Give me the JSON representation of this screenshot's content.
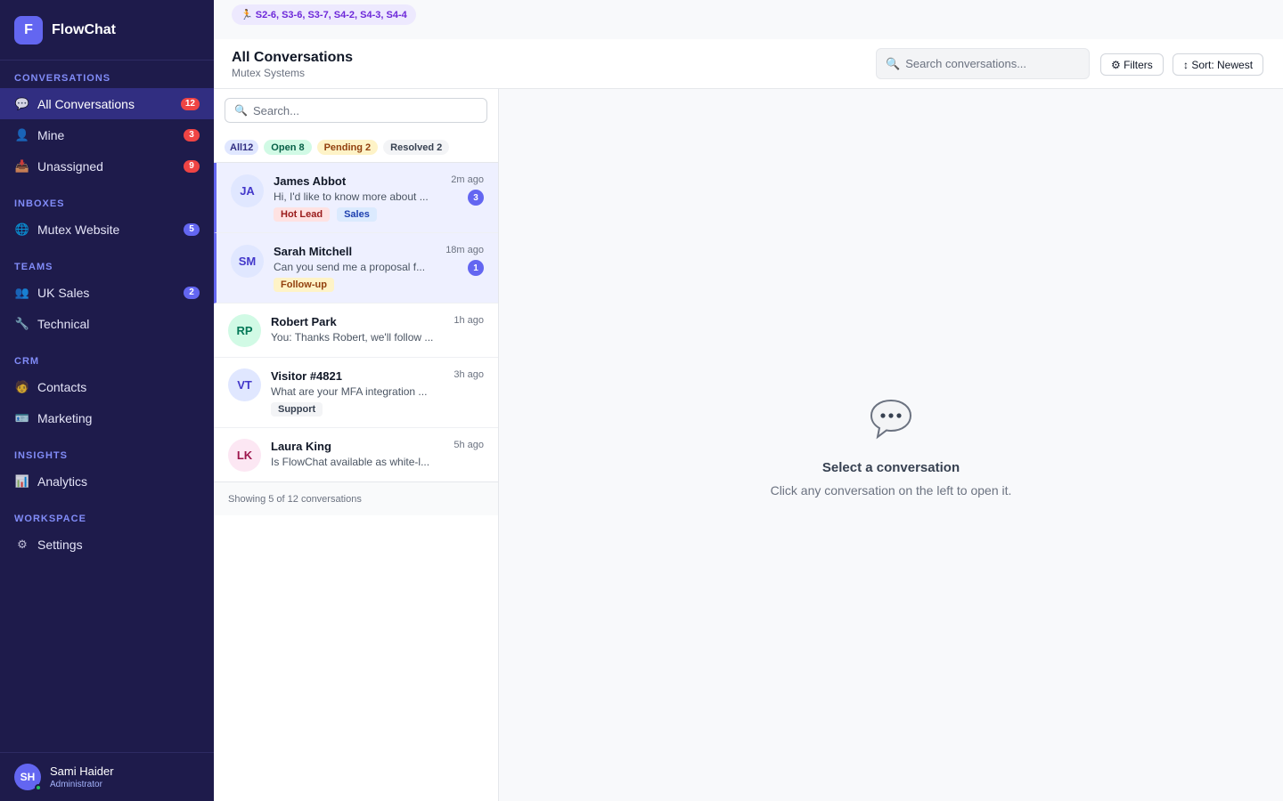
{
  "app": {
    "logo_letter": "F",
    "name": "FlowChat"
  },
  "story": {
    "label": "🏃 S2-6, S3-6, S3-7, S4-2, S4-3, S4-4"
  },
  "sidebar": {
    "sections": {
      "conversations": "CONVERSATIONS",
      "inboxes": "INBOXES",
      "teams": "TEAMS",
      "crm": "CRM",
      "insights": "INSIGHTS",
      "workspace": "WORKSPACE"
    },
    "items": {
      "all": {
        "label": "All Conversations",
        "count": "12",
        "icon": "chat-bubble-icon"
      },
      "mine": {
        "label": "Mine",
        "count": "3",
        "icon": "person-icon"
      },
      "unassigned": {
        "label": "Unassigned",
        "count": "9",
        "icon": "inbox-tray-icon"
      },
      "website": {
        "label": "Mutex Website",
        "count": "5",
        "icon": "globe-icon"
      },
      "uksales": {
        "label": "UK Sales",
        "count": "2",
        "icon": "people-icon"
      },
      "technical": {
        "label": "Technical",
        "icon": "wrench-icon"
      },
      "contacts": {
        "label": "Contacts",
        "icon": "contact-person-icon"
      },
      "marketing": {
        "label": "Marketing",
        "icon": "id-card-icon"
      },
      "analytics": {
        "label": "Analytics",
        "icon": "bar-chart-icon"
      },
      "settings": {
        "label": "Settings",
        "icon": "gear-icon"
      }
    },
    "user": {
      "initials": "SH",
      "name": "Sami Haider",
      "role": "Administrator"
    }
  },
  "header": {
    "title": "All Conversations",
    "subtitle": "Mutex Systems",
    "search_placeholder": "Search conversations...",
    "filters_label": "⚙ Filters",
    "sort_label": "↕ Sort: Newest"
  },
  "list": {
    "search_placeholder": "Search...",
    "filters": {
      "all": "All12",
      "open": "Open 8",
      "pending": "Pending 2",
      "resolved": "Resolved 2"
    },
    "conversations": [
      {
        "initials": "JA",
        "name": "James Abbot",
        "preview": "Hi, I'd like to know more about ...",
        "time": "2m ago",
        "unread": "3",
        "tags": [
          "Hot Lead",
          "Sales"
        ]
      },
      {
        "initials": "SM",
        "name": "Sarah Mitchell",
        "preview": "Can you send me a proposal f...",
        "time": "18m ago",
        "unread": "1",
        "tags": [
          "Follow-up"
        ]
      },
      {
        "initials": "RP",
        "name": "Robert Park",
        "preview": "You: Thanks Robert, we'll follow ...",
        "time": "1h ago"
      },
      {
        "initials": "VT",
        "name": "Visitor #4821",
        "preview": "What are your MFA integration ...",
        "time": "3h ago",
        "tags": [
          "Support"
        ]
      },
      {
        "initials": "LK",
        "name": "Laura King",
        "preview": "Is FlowChat available as white-l...",
        "time": "5h ago"
      }
    ],
    "footer": "Showing 5 of 12 conversations"
  },
  "empty_state": {
    "icon": "speech-bubble-icon",
    "title": "Select a conversation",
    "text": "Click any conversation on the left to open it."
  },
  "colors": {
    "sidebar_bg": "#1e1b4b",
    "accent": "#6366f1",
    "badge_red": "#ef4444"
  }
}
